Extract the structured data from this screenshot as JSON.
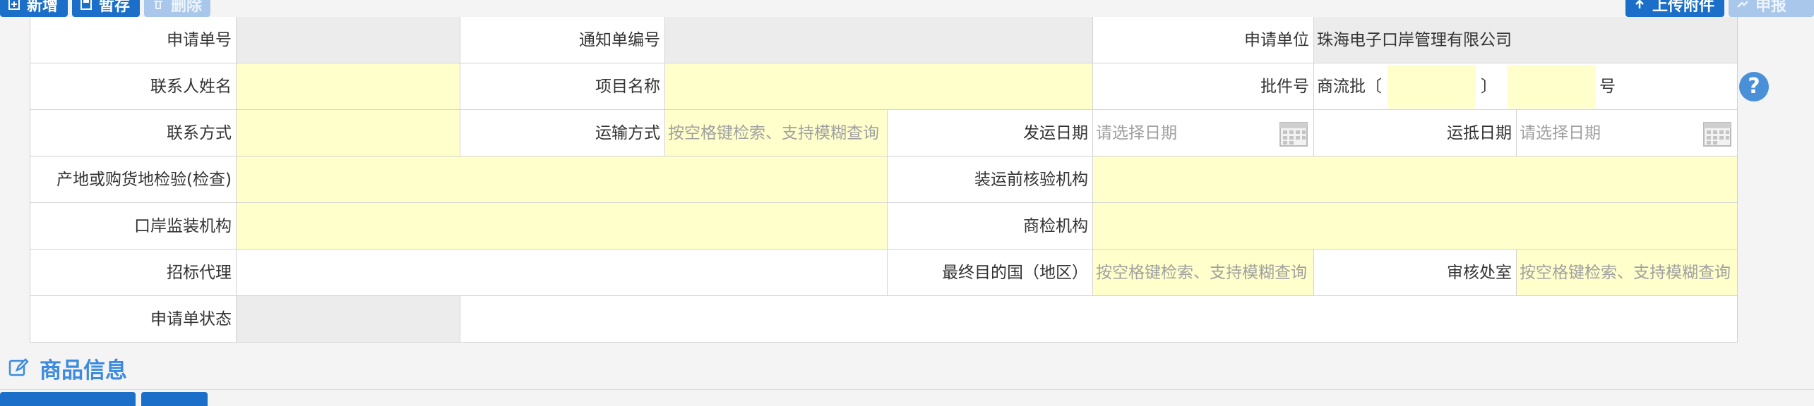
{
  "toolbar": {
    "add_label": "新增",
    "save_label": "暂存",
    "delete_label": "删除",
    "upload_label": "上传附件",
    "submit_label": "申报"
  },
  "form": {
    "application_no": {
      "label": "申请单号",
      "value": ""
    },
    "notice_no": {
      "label": "通知单编号",
      "value": ""
    },
    "applicant_unit": {
      "label": "申请单位",
      "value": "珠海电子口岸管理有限公司"
    },
    "contact_name": {
      "label": "联系人姓名",
      "value": ""
    },
    "project_name": {
      "label": "项目名称",
      "value": ""
    },
    "approval_no": {
      "label": "批件号",
      "prefix": "商流批〔",
      "middle": "〕",
      "suffix": "号"
    },
    "contact_method": {
      "label": "联系方式",
      "value": ""
    },
    "transport_mode": {
      "label": "运输方式",
      "placeholder": "按空格键检索、支持模糊查询"
    },
    "ship_date": {
      "label": "发运日期",
      "placeholder": "请选择日期"
    },
    "arrival_date": {
      "label": "运抵日期",
      "placeholder": "请选择日期"
    },
    "origin_inspection": {
      "label": "产地或购货地检验(检查)",
      "value": ""
    },
    "pre_shipment_agency": {
      "label": "装运前核验机构",
      "value": ""
    },
    "port_supervision": {
      "label": "口岸监装机构",
      "value": ""
    },
    "commodity_inspection": {
      "label": "商检机构",
      "value": ""
    },
    "tender_agent": {
      "label": "招标代理",
      "value": ""
    },
    "destination_country": {
      "label": "最终目的国（地区）",
      "placeholder": "按空格键检索、支持模糊查询"
    },
    "review_office": {
      "label": "审核处室",
      "placeholder": "按空格键检索、支持模糊查询"
    },
    "application_status": {
      "label": "申请单状态",
      "value": ""
    }
  },
  "help_label": "?",
  "section": {
    "title": "商品信息"
  },
  "colors": {
    "primary": "#1b6fc8",
    "required_bg": "#ffffcc",
    "readonly_bg": "#ececec",
    "accent_text": "#3c8be0"
  },
  "icons": [
    "add-icon",
    "save-icon",
    "delete-icon",
    "upload-icon",
    "submit-icon",
    "calendar-icon",
    "help-icon",
    "edit-icon"
  ]
}
